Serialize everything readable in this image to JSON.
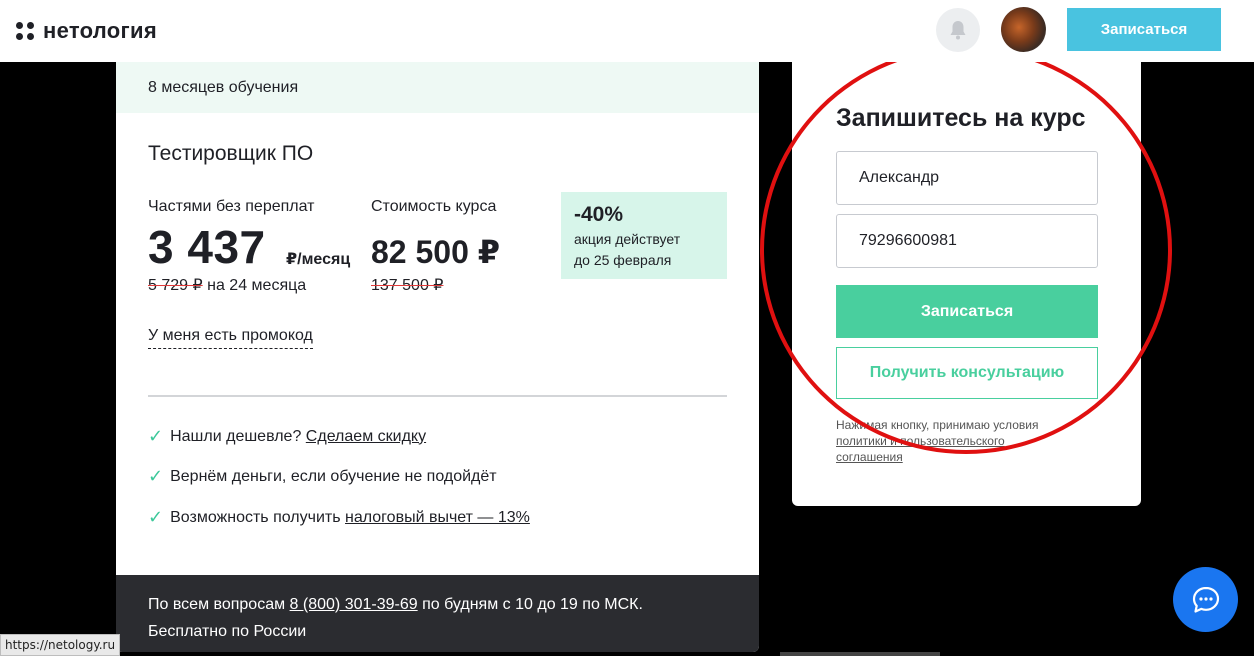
{
  "header": {
    "logo_text": "нетология",
    "signup_label": "Записаться",
    "icons": [
      "bell-icon",
      "avatar"
    ]
  },
  "course": {
    "duration": "8 месяцев обучения",
    "title": "Тестировщик ПО",
    "installment_label": "Частями без переплат",
    "installment_price": "3 437",
    "installment_unit": "₽/месяц",
    "installment_old": "5 729 ₽",
    "installment_term": "на 24 месяца",
    "cost_label": "Стоимость курса",
    "cost_price": "82 500 ₽",
    "cost_old": "137 500 ₽",
    "promo_percent": "-40%",
    "promo_line1": "акция действует",
    "promo_line2": "до 25 февраля",
    "promocode_link": "У меня есть промокод",
    "benefits": {
      "b1_text": "Нашли дешевле?",
      "b1_link": "Сделаем скидку",
      "b2_text": "Вернём деньги, если обучение не подойдёт",
      "b3_text": "Возможность получить",
      "b3_link": "налоговый вычет — 13%"
    },
    "footer_prefix": "По всем вопросам",
    "footer_phone": "8 (800) 301-39-69",
    "footer_suffix": "по будням с 10 до 19 по МСК.",
    "footer_line2": "Бесплатно по России"
  },
  "signup_form": {
    "title": "Запишитесь на курс",
    "name_value": "Александр",
    "phone_value": "79296600981",
    "submit_label": "Записаться",
    "consult_label": "Получить консультацию",
    "agree_prefix": "Нажимая кнопку, принимаю условия",
    "agree_link1": "политики и пользовательского",
    "agree_link2": "соглашения"
  },
  "status_bar": {
    "url": "https://netology.ru"
  },
  "colors": {
    "accent_green": "#49cf9e",
    "accent_blue": "#49c3e0",
    "annotation_red": "#e01010",
    "chat_blue": "#1a76f0"
  }
}
